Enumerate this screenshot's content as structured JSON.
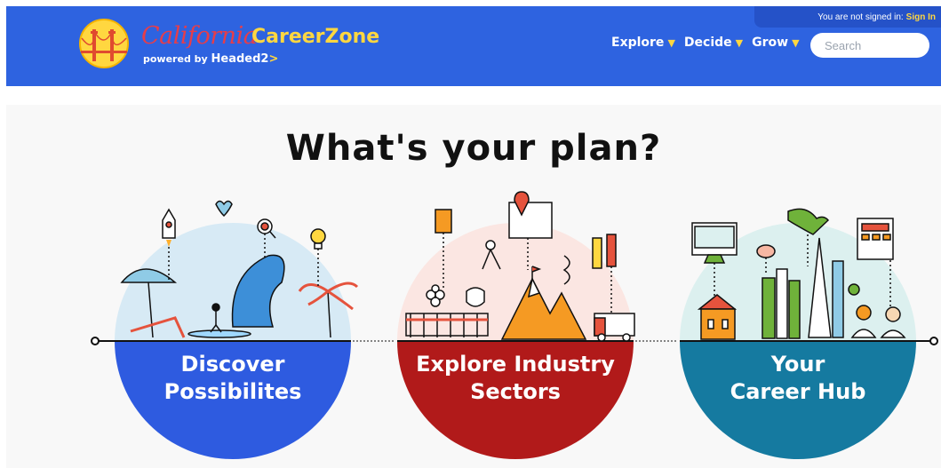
{
  "header": {
    "signin_text": "You are not signed in:",
    "signin_link": "Sign In",
    "brand_california": "California",
    "brand_careerzone": "CareerZone",
    "brand_powered": "powered by",
    "brand_headed": "Headed2",
    "brand_arrow": ">",
    "nav": [
      {
        "label": "Explore"
      },
      {
        "label": "Decide"
      },
      {
        "label": "Grow"
      }
    ],
    "search_placeholder": "Search"
  },
  "main": {
    "headline": "What's your plan?",
    "sections": [
      {
        "line1": "Discover",
        "line2": "Possibilites",
        "color": "#2e5be0"
      },
      {
        "line1": "Explore Industry",
        "line2": "Sectors",
        "color": "#b11a1a"
      },
      {
        "line1": "Your",
        "line2": "Career Hub",
        "color": "#157aa0"
      }
    ]
  },
  "colors": {
    "header_bg": "#2e63e0",
    "accent_yellow": "#ffd740",
    "brand_red": "#e63d4a"
  }
}
